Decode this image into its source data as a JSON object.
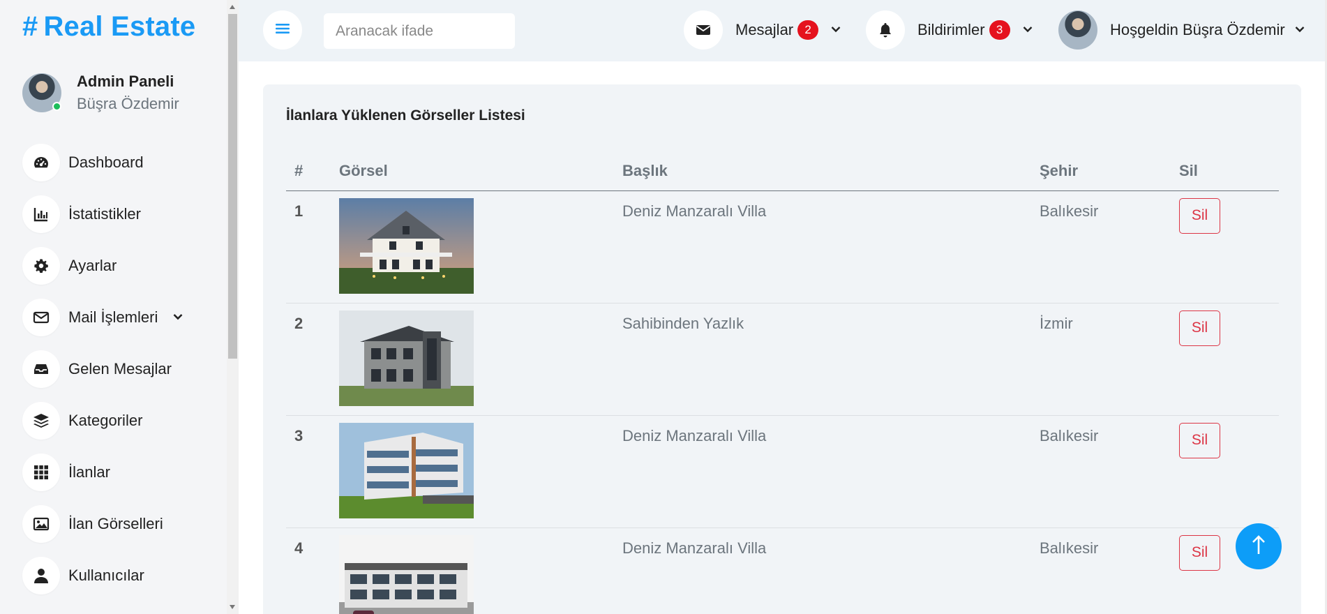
{
  "brand": {
    "hash": "#",
    "name": "Real Estate",
    "color": "#1a9af5"
  },
  "profile": {
    "role": "Admin Paneli",
    "name": "Büşra Özdemir"
  },
  "sidebar": {
    "items": [
      {
        "label": "Dashboard",
        "icon": "speedometer-icon"
      },
      {
        "label": "İstatistikler",
        "icon": "bar-chart-icon"
      },
      {
        "label": "Ayarlar",
        "icon": "gear-icon"
      },
      {
        "label": "Mail İşlemleri",
        "icon": "envelope-icon",
        "has_submenu": true
      },
      {
        "label": "Gelen Mesajlar",
        "icon": "inbox-icon"
      },
      {
        "label": "Kategoriler",
        "icon": "layers-icon"
      },
      {
        "label": "İlanlar",
        "icon": "grid-icon"
      },
      {
        "label": "İlan Görselleri",
        "icon": "image-icon"
      },
      {
        "label": "Kullanıcılar",
        "icon": "user-icon"
      }
    ]
  },
  "topbar": {
    "search_placeholder": "Aranacak ifade",
    "messages": {
      "label": "Mesajlar",
      "count": "2"
    },
    "notifications": {
      "label": "Bildirimler",
      "count": "3"
    },
    "user": {
      "greeting": "Hoşgeldin Büşra Özdemir"
    }
  },
  "main": {
    "title": "İlanlara Yüklenen Görseller Listesi",
    "columns": [
      "#",
      "Görsel",
      "Başlık",
      "Şehir",
      "Sil"
    ],
    "rows": [
      {
        "num": "1",
        "title": "Deniz Manzaralı Villa",
        "city": "Balıkesir",
        "delete_label": "Sil"
      },
      {
        "num": "2",
        "title": "Sahibinden Yazlık",
        "city": "İzmir",
        "delete_label": "Sil"
      },
      {
        "num": "3",
        "title": "Deniz Manzaralı Villa",
        "city": "Balıkesir",
        "delete_label": "Sil"
      },
      {
        "num": "4",
        "title": "Deniz Manzaralı Villa",
        "city": "Balıkesir",
        "delete_label": "Sil"
      }
    ]
  },
  "colors": {
    "accent": "#1a9af5",
    "danger": "#dc3545",
    "badge": "#e5121e",
    "online": "#1dbd5a"
  }
}
